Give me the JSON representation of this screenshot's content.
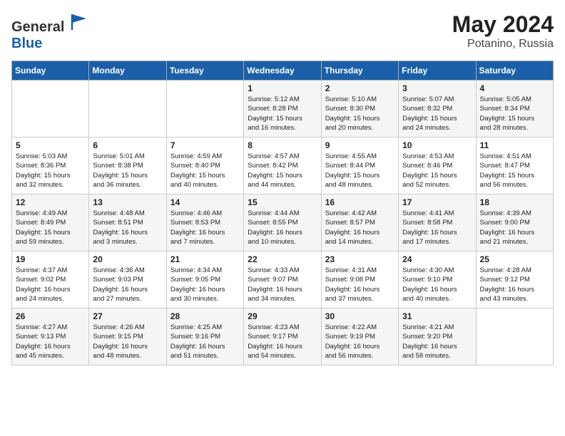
{
  "header": {
    "logo_general": "General",
    "logo_blue": "Blue",
    "month_year": "May 2024",
    "location": "Potanino, Russia"
  },
  "days_of_week": [
    "Sunday",
    "Monday",
    "Tuesday",
    "Wednesday",
    "Thursday",
    "Friday",
    "Saturday"
  ],
  "weeks": [
    [
      {
        "day": "",
        "info": ""
      },
      {
        "day": "",
        "info": ""
      },
      {
        "day": "",
        "info": ""
      },
      {
        "day": "1",
        "info": "Sunrise: 5:12 AM\nSunset: 8:28 PM\nDaylight: 15 hours\nand 16 minutes."
      },
      {
        "day": "2",
        "info": "Sunrise: 5:10 AM\nSunset: 8:30 PM\nDaylight: 15 hours\nand 20 minutes."
      },
      {
        "day": "3",
        "info": "Sunrise: 5:07 AM\nSunset: 8:32 PM\nDaylight: 15 hours\nand 24 minutes."
      },
      {
        "day": "4",
        "info": "Sunrise: 5:05 AM\nSunset: 8:34 PM\nDaylight: 15 hours\nand 28 minutes."
      }
    ],
    [
      {
        "day": "5",
        "info": "Sunrise: 5:03 AM\nSunset: 8:36 PM\nDaylight: 15 hours\nand 32 minutes."
      },
      {
        "day": "6",
        "info": "Sunrise: 5:01 AM\nSunset: 8:38 PM\nDaylight: 15 hours\nand 36 minutes."
      },
      {
        "day": "7",
        "info": "Sunrise: 4:59 AM\nSunset: 8:40 PM\nDaylight: 15 hours\nand 40 minutes."
      },
      {
        "day": "8",
        "info": "Sunrise: 4:57 AM\nSunset: 8:42 PM\nDaylight: 15 hours\nand 44 minutes."
      },
      {
        "day": "9",
        "info": "Sunrise: 4:55 AM\nSunset: 8:44 PM\nDaylight: 15 hours\nand 48 minutes."
      },
      {
        "day": "10",
        "info": "Sunrise: 4:53 AM\nSunset: 8:46 PM\nDaylight: 15 hours\nand 52 minutes."
      },
      {
        "day": "11",
        "info": "Sunrise: 4:51 AM\nSunset: 8:47 PM\nDaylight: 15 hours\nand 56 minutes."
      }
    ],
    [
      {
        "day": "12",
        "info": "Sunrise: 4:49 AM\nSunset: 8:49 PM\nDaylight: 15 hours\nand 59 minutes."
      },
      {
        "day": "13",
        "info": "Sunrise: 4:48 AM\nSunset: 8:51 PM\nDaylight: 16 hours\nand 3 minutes."
      },
      {
        "day": "14",
        "info": "Sunrise: 4:46 AM\nSunset: 8:53 PM\nDaylight: 16 hours\nand 7 minutes."
      },
      {
        "day": "15",
        "info": "Sunrise: 4:44 AM\nSunset: 8:55 PM\nDaylight: 16 hours\nand 10 minutes."
      },
      {
        "day": "16",
        "info": "Sunrise: 4:42 AM\nSunset: 8:57 PM\nDaylight: 16 hours\nand 14 minutes."
      },
      {
        "day": "17",
        "info": "Sunrise: 4:41 AM\nSunset: 8:58 PM\nDaylight: 16 hours\nand 17 minutes."
      },
      {
        "day": "18",
        "info": "Sunrise: 4:39 AM\nSunset: 9:00 PM\nDaylight: 16 hours\nand 21 minutes."
      }
    ],
    [
      {
        "day": "19",
        "info": "Sunrise: 4:37 AM\nSunset: 9:02 PM\nDaylight: 16 hours\nand 24 minutes."
      },
      {
        "day": "20",
        "info": "Sunrise: 4:36 AM\nSunset: 9:03 PM\nDaylight: 16 hours\nand 27 minutes."
      },
      {
        "day": "21",
        "info": "Sunrise: 4:34 AM\nSunset: 9:05 PM\nDaylight: 16 hours\nand 30 minutes."
      },
      {
        "day": "22",
        "info": "Sunrise: 4:33 AM\nSunset: 9:07 PM\nDaylight: 16 hours\nand 34 minutes."
      },
      {
        "day": "23",
        "info": "Sunrise: 4:31 AM\nSunset: 9:08 PM\nDaylight: 16 hours\nand 37 minutes."
      },
      {
        "day": "24",
        "info": "Sunrise: 4:30 AM\nSunset: 9:10 PM\nDaylight: 16 hours\nand 40 minutes."
      },
      {
        "day": "25",
        "info": "Sunrise: 4:28 AM\nSunset: 9:12 PM\nDaylight: 16 hours\nand 43 minutes."
      }
    ],
    [
      {
        "day": "26",
        "info": "Sunrise: 4:27 AM\nSunset: 9:13 PM\nDaylight: 16 hours\nand 45 minutes."
      },
      {
        "day": "27",
        "info": "Sunrise: 4:26 AM\nSunset: 9:15 PM\nDaylight: 16 hours\nand 48 minutes."
      },
      {
        "day": "28",
        "info": "Sunrise: 4:25 AM\nSunset: 9:16 PM\nDaylight: 16 hours\nand 51 minutes."
      },
      {
        "day": "29",
        "info": "Sunrise: 4:23 AM\nSunset: 9:17 PM\nDaylight: 16 hours\nand 54 minutes."
      },
      {
        "day": "30",
        "info": "Sunrise: 4:22 AM\nSunset: 9:19 PM\nDaylight: 16 hours\nand 56 minutes."
      },
      {
        "day": "31",
        "info": "Sunrise: 4:21 AM\nSunset: 9:20 PM\nDaylight: 16 hours\nand 58 minutes."
      },
      {
        "day": "",
        "info": ""
      }
    ]
  ]
}
